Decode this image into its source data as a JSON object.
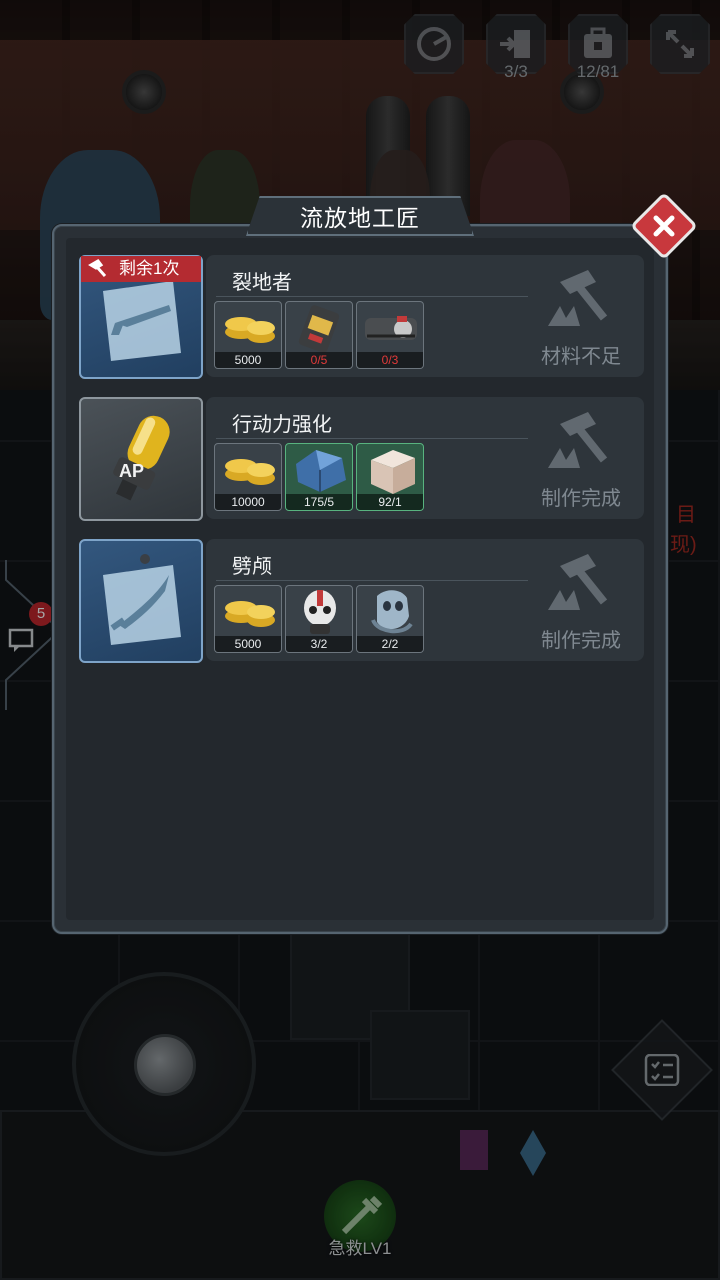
{
  "hud": {
    "radar_icon": "radar-icon",
    "exit_count": "3/3",
    "backpack_count": "12/81",
    "expand_icon": "expand-icon"
  },
  "chat": {
    "badge": "5",
    "icon": "chat-icon"
  },
  "background_text": {
    "line1": "目",
    "line2": "现)"
  },
  "skill": {
    "label": "急救LV1"
  },
  "panel": {
    "title": "流放地工匠",
    "close_icon": "close-icon"
  },
  "recipes": [
    {
      "name": "裂地者",
      "remaining": "剩余1次",
      "item_icon": "shotgun-blueprint-icon",
      "card_color": "#33577e",
      "status": "材料不足",
      "materials": [
        {
          "icon": "gold-coins-icon",
          "count": "5000",
          "enough": true
        },
        {
          "icon": "battery-cell-icon",
          "count": "0/5",
          "enough": false
        },
        {
          "icon": "engine-part-icon",
          "count": "0/3",
          "enough": false
        }
      ]
    },
    {
      "name": "行动力强化",
      "item_icon": "ap-injector-icon",
      "card_color": "#4b5258",
      "status": "制作完成",
      "materials": [
        {
          "icon": "gold-coins-icon",
          "count": "10000",
          "enough": true
        },
        {
          "icon": "crystal-ore-icon",
          "count": "175/5",
          "enough": true
        },
        {
          "icon": "stone-block-icon",
          "count": "92/1",
          "enough": true
        }
      ]
    },
    {
      "name": "劈颅",
      "item_icon": "blade-blueprint-icon",
      "card_color": "#33577e",
      "status": "制作完成",
      "materials": [
        {
          "icon": "gold-coins-icon",
          "count": "5000",
          "enough": true
        },
        {
          "icon": "skull-mask-icon",
          "count": "3/2",
          "enough": true
        },
        {
          "icon": "metal-mask-icon",
          "count": "2/2",
          "enough": true
        }
      ]
    }
  ],
  "colors": {
    "accent_red": "#c8383d",
    "insufficient_red": "#e23a3a",
    "blue_card": "#33577e",
    "green_material": "#2e5b46"
  }
}
